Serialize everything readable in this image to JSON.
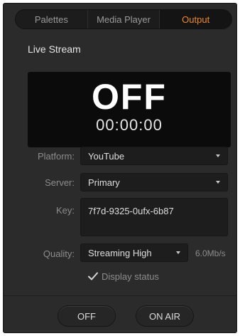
{
  "tabs": [
    {
      "label": "Palettes"
    },
    {
      "label": "Media Player"
    },
    {
      "label": "Output"
    }
  ],
  "active_tab": "Output",
  "accent_color": "#f08a24",
  "section_title": "Live Stream",
  "status": {
    "state": "OFF",
    "timer": "00:00:00"
  },
  "form": {
    "platform_label": "Platform:",
    "platform_value": "YouTube",
    "server_label": "Server:",
    "server_value": "Primary",
    "key_label": "Key:",
    "key_value": "7f7d-9325-0ufx-6b87",
    "quality_label": "Quality:",
    "quality_value": "Streaming High",
    "quality_rate": "6.0Mb/s",
    "display_status_label": "Display status",
    "display_status_checked": true
  },
  "buttons": {
    "off_label": "OFF",
    "on_air_label": "ON AIR"
  }
}
